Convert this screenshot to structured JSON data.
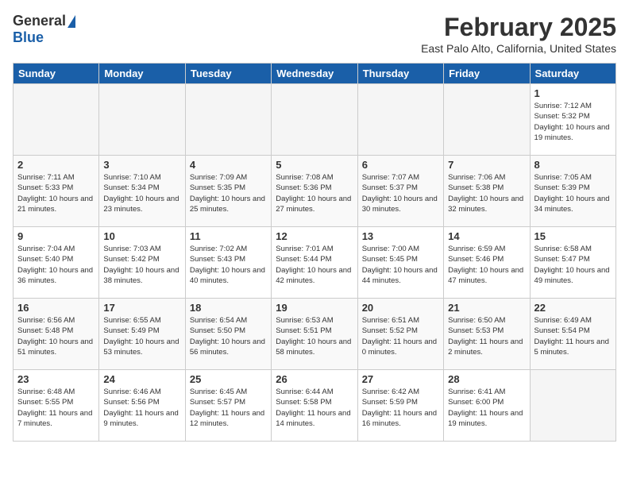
{
  "header": {
    "logo_general": "General",
    "logo_blue": "Blue",
    "title": "February 2025",
    "subtitle": "East Palo Alto, California, United States"
  },
  "days_of_week": [
    "Sunday",
    "Monday",
    "Tuesday",
    "Wednesday",
    "Thursday",
    "Friday",
    "Saturday"
  ],
  "weeks": [
    [
      {
        "day": "",
        "info": "",
        "empty": true
      },
      {
        "day": "",
        "info": "",
        "empty": true
      },
      {
        "day": "",
        "info": "",
        "empty": true
      },
      {
        "day": "",
        "info": "",
        "empty": true
      },
      {
        "day": "",
        "info": "",
        "empty": true
      },
      {
        "day": "",
        "info": "",
        "empty": true
      },
      {
        "day": "1",
        "info": "Sunrise: 7:12 AM\nSunset: 5:32 PM\nDaylight: 10 hours\nand 19 minutes.",
        "empty": false
      }
    ],
    [
      {
        "day": "2",
        "info": "Sunrise: 7:11 AM\nSunset: 5:33 PM\nDaylight: 10 hours\nand 21 minutes.",
        "empty": false
      },
      {
        "day": "3",
        "info": "Sunrise: 7:10 AM\nSunset: 5:34 PM\nDaylight: 10 hours\nand 23 minutes.",
        "empty": false
      },
      {
        "day": "4",
        "info": "Sunrise: 7:09 AM\nSunset: 5:35 PM\nDaylight: 10 hours\nand 25 minutes.",
        "empty": false
      },
      {
        "day": "5",
        "info": "Sunrise: 7:08 AM\nSunset: 5:36 PM\nDaylight: 10 hours\nand 27 minutes.",
        "empty": false
      },
      {
        "day": "6",
        "info": "Sunrise: 7:07 AM\nSunset: 5:37 PM\nDaylight: 10 hours\nand 30 minutes.",
        "empty": false
      },
      {
        "day": "7",
        "info": "Sunrise: 7:06 AM\nSunset: 5:38 PM\nDaylight: 10 hours\nand 32 minutes.",
        "empty": false
      },
      {
        "day": "8",
        "info": "Sunrise: 7:05 AM\nSunset: 5:39 PM\nDaylight: 10 hours\nand 34 minutes.",
        "empty": false
      }
    ],
    [
      {
        "day": "9",
        "info": "Sunrise: 7:04 AM\nSunset: 5:40 PM\nDaylight: 10 hours\nand 36 minutes.",
        "empty": false
      },
      {
        "day": "10",
        "info": "Sunrise: 7:03 AM\nSunset: 5:42 PM\nDaylight: 10 hours\nand 38 minutes.",
        "empty": false
      },
      {
        "day": "11",
        "info": "Sunrise: 7:02 AM\nSunset: 5:43 PM\nDaylight: 10 hours\nand 40 minutes.",
        "empty": false
      },
      {
        "day": "12",
        "info": "Sunrise: 7:01 AM\nSunset: 5:44 PM\nDaylight: 10 hours\nand 42 minutes.",
        "empty": false
      },
      {
        "day": "13",
        "info": "Sunrise: 7:00 AM\nSunset: 5:45 PM\nDaylight: 10 hours\nand 44 minutes.",
        "empty": false
      },
      {
        "day": "14",
        "info": "Sunrise: 6:59 AM\nSunset: 5:46 PM\nDaylight: 10 hours\nand 47 minutes.",
        "empty": false
      },
      {
        "day": "15",
        "info": "Sunrise: 6:58 AM\nSunset: 5:47 PM\nDaylight: 10 hours\nand 49 minutes.",
        "empty": false
      }
    ],
    [
      {
        "day": "16",
        "info": "Sunrise: 6:56 AM\nSunset: 5:48 PM\nDaylight: 10 hours\nand 51 minutes.",
        "empty": false
      },
      {
        "day": "17",
        "info": "Sunrise: 6:55 AM\nSunset: 5:49 PM\nDaylight: 10 hours\nand 53 minutes.",
        "empty": false
      },
      {
        "day": "18",
        "info": "Sunrise: 6:54 AM\nSunset: 5:50 PM\nDaylight: 10 hours\nand 56 minutes.",
        "empty": false
      },
      {
        "day": "19",
        "info": "Sunrise: 6:53 AM\nSunset: 5:51 PM\nDaylight: 10 hours\nand 58 minutes.",
        "empty": false
      },
      {
        "day": "20",
        "info": "Sunrise: 6:51 AM\nSunset: 5:52 PM\nDaylight: 11 hours\nand 0 minutes.",
        "empty": false
      },
      {
        "day": "21",
        "info": "Sunrise: 6:50 AM\nSunset: 5:53 PM\nDaylight: 11 hours\nand 2 minutes.",
        "empty": false
      },
      {
        "day": "22",
        "info": "Sunrise: 6:49 AM\nSunset: 5:54 PM\nDaylight: 11 hours\nand 5 minutes.",
        "empty": false
      }
    ],
    [
      {
        "day": "23",
        "info": "Sunrise: 6:48 AM\nSunset: 5:55 PM\nDaylight: 11 hours\nand 7 minutes.",
        "empty": false
      },
      {
        "day": "24",
        "info": "Sunrise: 6:46 AM\nSunset: 5:56 PM\nDaylight: 11 hours\nand 9 minutes.",
        "empty": false
      },
      {
        "day": "25",
        "info": "Sunrise: 6:45 AM\nSunset: 5:57 PM\nDaylight: 11 hours\nand 12 minutes.",
        "empty": false
      },
      {
        "day": "26",
        "info": "Sunrise: 6:44 AM\nSunset: 5:58 PM\nDaylight: 11 hours\nand 14 minutes.",
        "empty": false
      },
      {
        "day": "27",
        "info": "Sunrise: 6:42 AM\nSunset: 5:59 PM\nDaylight: 11 hours\nand 16 minutes.",
        "empty": false
      },
      {
        "day": "28",
        "info": "Sunrise: 6:41 AM\nSunset: 6:00 PM\nDaylight: 11 hours\nand 19 minutes.",
        "empty": false
      },
      {
        "day": "",
        "info": "",
        "empty": true
      }
    ]
  ]
}
